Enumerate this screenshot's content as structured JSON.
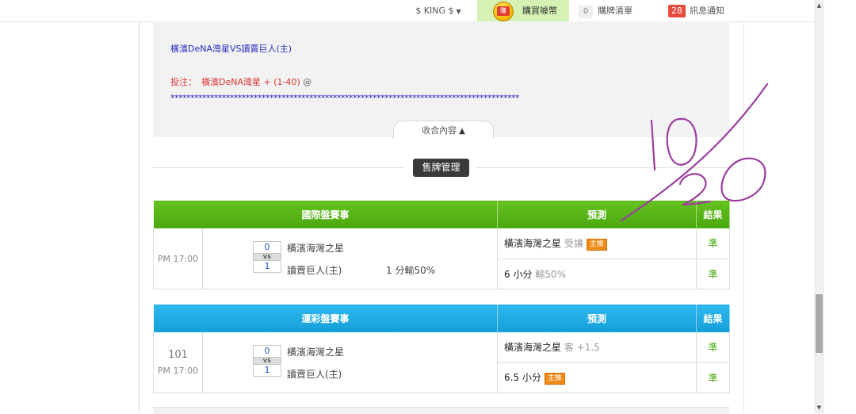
{
  "topbar": {
    "king": "$ KING $",
    "buy_coin_badge": "賺",
    "buy_coin_label": "購買噱幣",
    "list_count": "0",
    "list_label": "購牌清單",
    "notif_count": "28",
    "notif_label": "訊息通知"
  },
  "post": {
    "title": "橫濱DeNA灣星VS讀賣巨人(主)",
    "bet_label": "投注：",
    "bet_text": "橫濱DeNA灣星 + (1-40)",
    "bet_at": "@",
    "stars": "****************************************************************************************",
    "collapse_label": "收合內容"
  },
  "sell_button": "售牌管理",
  "table1": {
    "header_event": "國際盤賽事",
    "header_pred": "預測",
    "header_result": "結果",
    "row": {
      "time": "PM 17:00",
      "score_top": "0",
      "vs": "VS",
      "score_bottom": "1",
      "team1": "橫濱海灣之星",
      "team2": "讀賣巨人(主)",
      "extra": "1 分輸50%",
      "pred1_main": "橫濱海灣之星",
      "pred1_gray": "受讓",
      "pred1_badge": "主推",
      "result1": "準",
      "pred2_main": "6 小分",
      "pred2_gray": "輸50%",
      "result2": "準"
    }
  },
  "table2": {
    "header_event": "運彩盤賽事",
    "header_pred": "預測",
    "header_result": "結果",
    "row": {
      "number": "101",
      "time": "PM 17:00",
      "score_top": "0",
      "vs": "VS",
      "score_bottom": "1",
      "team1": "橫濱海灣之星",
      "team2": "讀賣巨人(主)",
      "pred1_main": "橫濱海灣之星",
      "pred1_gray": "客 +1.5",
      "result1": "準",
      "pred2_main": "6.5 小分",
      "pred2_badge": "主推",
      "result2": "準"
    }
  },
  "colors": {
    "green_header": "#4aa80f",
    "blue_header": "#159fd9",
    "badge_orange": "#f08a18",
    "notif_red": "#e64a3c",
    "handwriting_purple": "#9b3fa0"
  }
}
